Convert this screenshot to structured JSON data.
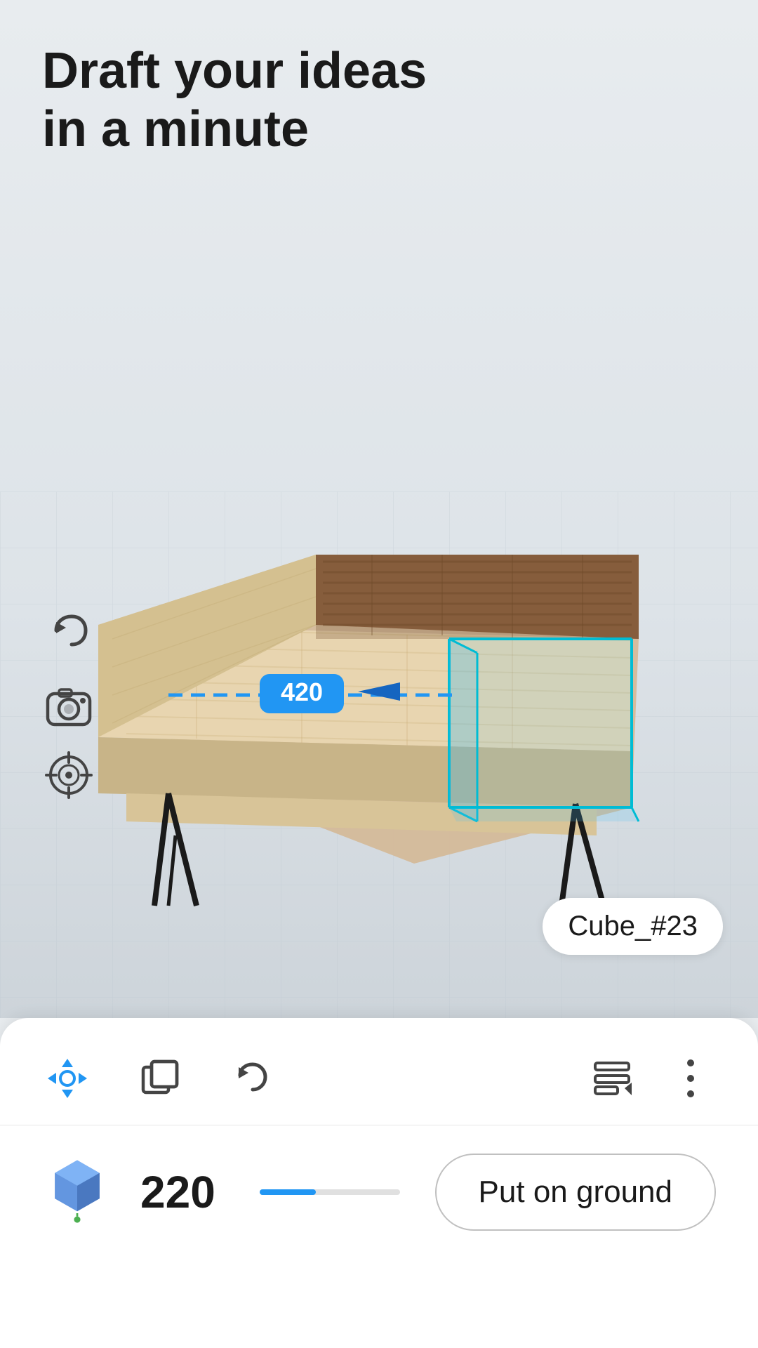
{
  "title": {
    "line1": "Draft your ideas",
    "line2": "in a minute"
  },
  "scene": {
    "background_color": "#e8ecef",
    "grid_color": "#c8d0d8",
    "object_label": "Cube_#23",
    "measurement_value": "420",
    "measurement_color": "#2196f3"
  },
  "toolbar": {
    "move_icon": "⊹",
    "layers_icon": "⧉",
    "undo_icon": "↺",
    "paint_icon": "⊟",
    "more_icon": "⋮"
  },
  "action_bar": {
    "height_value": "220",
    "put_on_ground_label": "Put on ground",
    "height_slider_percent": 40
  },
  "side_controls": {
    "undo_label": "undo",
    "camera_label": "camera",
    "target_label": "target"
  },
  "colors": {
    "accent": "#2196f3",
    "panel_bg": "#ffffff",
    "scene_bg": "#e8ecef",
    "text_primary": "#1a1a1a",
    "icon_inactive": "#555555"
  }
}
